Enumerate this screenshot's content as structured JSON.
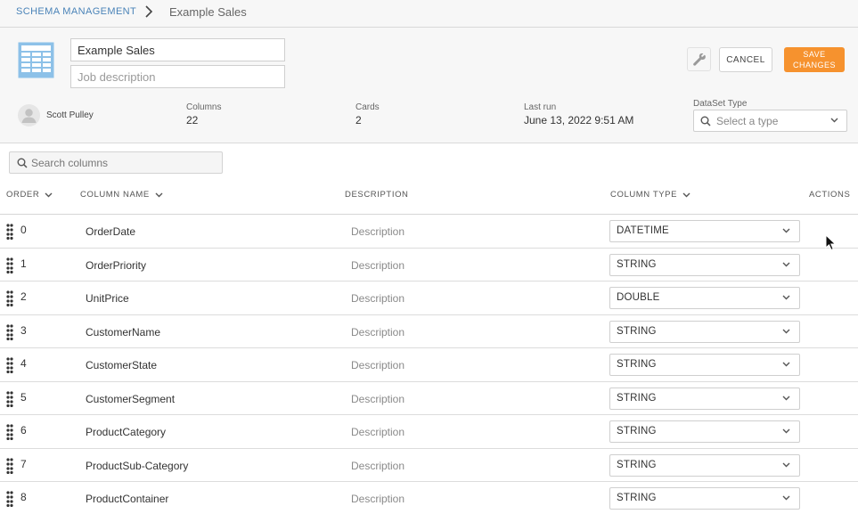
{
  "breadcrumb": {
    "parent_label": "SCHEMA MANAGEMENT",
    "current_label": "Example Sales"
  },
  "dataset": {
    "name": "Example Sales",
    "description_placeholder": "Job description",
    "owner": "Scott Pulley",
    "columns_label": "Columns",
    "columns_count": "22",
    "cards_label": "Cards",
    "cards_count": "2",
    "last_run_label": "Last run",
    "last_run_value": "June 13, 2022 9:51 AM",
    "type_label": "DataSet Type",
    "type_placeholder": "Select a type"
  },
  "toolbar": {
    "cancel_label": "CANCEL",
    "save_label": "SAVE\nCHANGES",
    "wrench_icon": "wrench-icon"
  },
  "colors": {
    "accent_link": "#4a83b8",
    "save_button": "#f6922e",
    "dataset_icon": "#8dc1e8"
  },
  "search": {
    "placeholder": "Search columns"
  },
  "table": {
    "headers": {
      "order": "ORDER",
      "column_name": "COLUMN NAME",
      "description": "DESCRIPTION",
      "column_type": "COLUMN TYPE",
      "actions": "ACTIONS"
    },
    "rows": [
      {
        "order": "0",
        "name": "OrderDate",
        "description": "Description",
        "type": "DATETIME"
      },
      {
        "order": "1",
        "name": "OrderPriority",
        "description": "Description",
        "type": "STRING"
      },
      {
        "order": "2",
        "name": "UnitPrice",
        "description": "Description",
        "type": "DOUBLE"
      },
      {
        "order": "3",
        "name": "CustomerName",
        "description": "Description",
        "type": "STRING"
      },
      {
        "order": "4",
        "name": "CustomerState",
        "description": "Description",
        "type": "STRING"
      },
      {
        "order": "5",
        "name": "CustomerSegment",
        "description": "Description",
        "type": "STRING"
      },
      {
        "order": "6",
        "name": "ProductCategory",
        "description": "Description",
        "type": "STRING"
      },
      {
        "order": "7",
        "name": "ProductSub-Category",
        "description": "Description",
        "type": "STRING"
      },
      {
        "order": "8",
        "name": "ProductContainer",
        "description": "Description",
        "type": "STRING"
      }
    ]
  }
}
